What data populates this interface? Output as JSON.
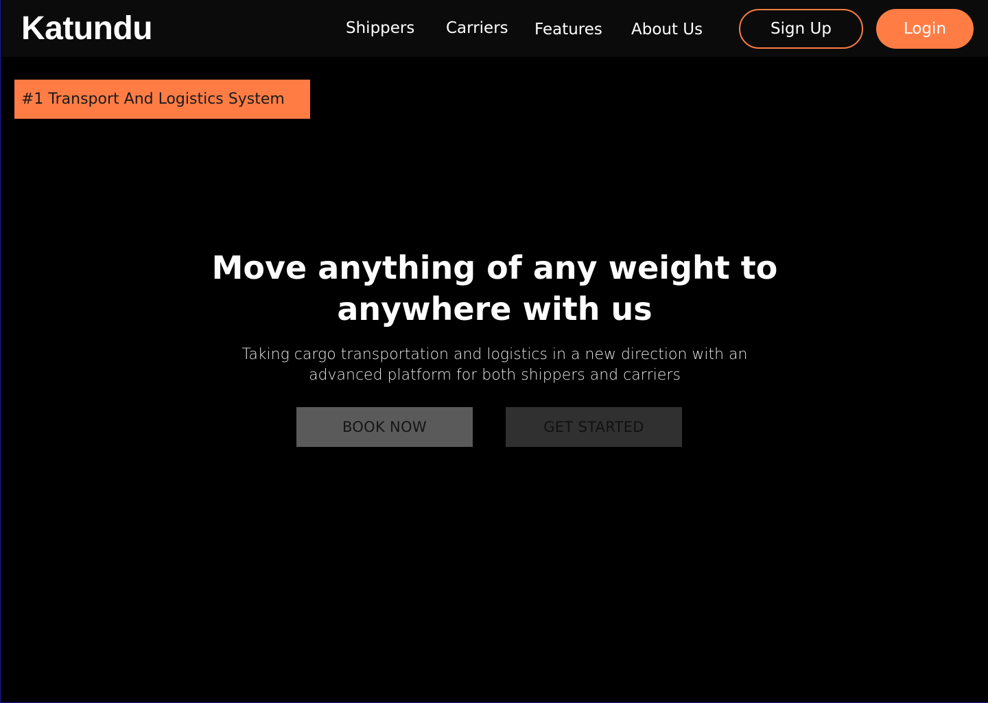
{
  "brand": {
    "name": "Katundu"
  },
  "nav": {
    "links": [
      "Shippers",
      "Carriers",
      "Features",
      "About Us"
    ],
    "signup_label": "Sign Up",
    "login_label": "Login"
  },
  "hero": {
    "badge": "#1 Transport And Logistics System",
    "title_line1": "Move anything of any weight to",
    "title_line2": "anywhere with us",
    "subtitle_line1": "Taking cargo transportation and logistics in a new direction with an",
    "subtitle_line2": "advanced platform for both shippers and carriers",
    "book_label": "BOOK NOW",
    "started_label": "GET STARTED"
  },
  "colors": {
    "accent": "#ff7d45",
    "nav_background": "#0b0b0b",
    "page_background": "#000000"
  }
}
